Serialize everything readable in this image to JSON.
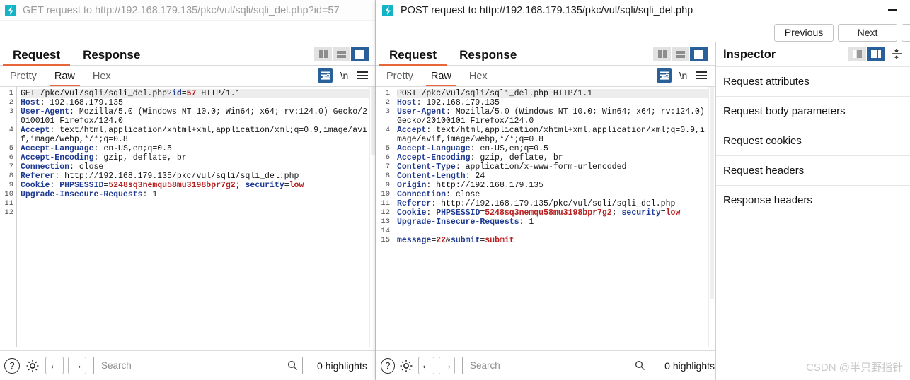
{
  "window_left": {
    "title": "GET request to http://192.168.179.135/pkc/vul/sqli/sqli_del.php?id=57",
    "logo_icon": "burp-suite-logo-icon",
    "tabs": [
      {
        "label": "Request",
        "active": true
      },
      {
        "label": "Response",
        "active": false
      }
    ],
    "layout_buttons": [
      {
        "name": "layout-side-by-side-icon",
        "selected": false
      },
      {
        "name": "layout-stacked-icon",
        "selected": false
      },
      {
        "name": "layout-single-pane-icon",
        "selected": true
      }
    ],
    "subtabs": [
      {
        "label": "Pretty",
        "active": false
      },
      {
        "label": "Raw",
        "active": true
      },
      {
        "label": "Hex",
        "active": false
      }
    ],
    "subtools": {
      "wrap_icon": "word-wrap-icon",
      "newline_label": "\\n",
      "menu_icon": "hamburger-menu-icon"
    },
    "code_lines": [
      {
        "n": "1",
        "segments": [
          {
            "t": "GET /pkc/vul/sqli/sqli_del.php?",
            "c": "pl"
          },
          {
            "t": "id",
            "c": "bl"
          },
          {
            "t": "=",
            "c": "pl"
          },
          {
            "t": "57",
            "c": "rd"
          },
          {
            "t": " HTTP/1.1",
            "c": "pl"
          }
        ]
      },
      {
        "n": "2",
        "segments": [
          {
            "t": "Host",
            "c": "hk"
          },
          {
            "t": ": 192.168.179.135",
            "c": "pl"
          }
        ]
      },
      {
        "n": "3",
        "segments": [
          {
            "t": "User-Agent",
            "c": "hk"
          },
          {
            "t": ": Mozilla/5.0 (Windows NT 10.0; Win64; x64; rv:124.0) Gecko/20100101 Firefox/124.0",
            "c": "pl"
          }
        ]
      },
      {
        "n": "4",
        "segments": [
          {
            "t": "Accept",
            "c": "hk"
          },
          {
            "t": ": text/html,application/xhtml+xml,application/xml;q=0.9,image/avif,image/webp,*/*;q=0.8",
            "c": "pl"
          }
        ]
      },
      {
        "n": "5",
        "segments": [
          {
            "t": "Accept-Language",
            "c": "hk"
          },
          {
            "t": ": en-US,en;q=0.5",
            "c": "pl"
          }
        ]
      },
      {
        "n": "6",
        "segments": [
          {
            "t": "Accept-Encoding",
            "c": "hk"
          },
          {
            "t": ": gzip, deflate, br",
            "c": "pl"
          }
        ]
      },
      {
        "n": "7",
        "segments": [
          {
            "t": "Connection",
            "c": "hk"
          },
          {
            "t": ": close",
            "c": "pl"
          }
        ]
      },
      {
        "n": "8",
        "segments": [
          {
            "t": "Referer",
            "c": "hk"
          },
          {
            "t": ": http://192.168.179.135/pkc/vul/sqli/sqli_del.php",
            "c": "pl"
          }
        ]
      },
      {
        "n": "9",
        "segments": [
          {
            "t": "Cookie",
            "c": "hk"
          },
          {
            "t": ": ",
            "c": "pl"
          },
          {
            "t": "PHPSESSID",
            "c": "bl"
          },
          {
            "t": "=",
            "c": "pl"
          },
          {
            "t": "5248sq3nemqu58mu3198bpr7g2",
            "c": "rd"
          },
          {
            "t": "; ",
            "c": "pl"
          },
          {
            "t": "security",
            "c": "bl"
          },
          {
            "t": "=",
            "c": "pl"
          },
          {
            "t": "low",
            "c": "rd"
          }
        ]
      },
      {
        "n": "10",
        "segments": [
          {
            "t": "Upgrade-Insecure-Requests",
            "c": "hk"
          },
          {
            "t": ": 1",
            "c": "pl"
          }
        ]
      },
      {
        "n": "11",
        "segments": []
      },
      {
        "n": "12",
        "segments": []
      }
    ],
    "bottom": {
      "help_label": "?",
      "help_icon": "help-circle-icon",
      "settings_icon": "gear-icon",
      "back_icon": "arrow-left-icon",
      "forward_icon": "arrow-right-icon",
      "search_placeholder": "Search",
      "search_value": "",
      "search_icon": "magnifier-icon",
      "highlights_label": "0 highlights"
    }
  },
  "window_right": {
    "title": "POST request to http://192.168.179.135/pkc/vul/sqli/sqli_del.php",
    "logo_icon": "burp-suite-logo-icon",
    "minimize_icon": "minimize-icon",
    "nav_buttons": [
      {
        "label": "Previous",
        "name": "previous-button"
      },
      {
        "label": "Next",
        "name": "next-button"
      }
    ],
    "tabs": [
      {
        "label": "Request",
        "active": true
      },
      {
        "label": "Response",
        "active": false
      }
    ],
    "layout_buttons": [
      {
        "name": "layout-side-by-side-icon",
        "selected": false
      },
      {
        "name": "layout-stacked-icon",
        "selected": false
      },
      {
        "name": "layout-single-pane-icon",
        "selected": true
      }
    ],
    "subtabs": [
      {
        "label": "Pretty",
        "active": false
      },
      {
        "label": "Raw",
        "active": true
      },
      {
        "label": "Hex",
        "active": false
      }
    ],
    "subtools": {
      "wrap_icon": "word-wrap-icon",
      "newline_label": "\\n",
      "menu_icon": "hamburger-menu-icon"
    },
    "code_lines": [
      {
        "n": "1",
        "segments": [
          {
            "t": "POST /pkc/vul/sqli/sqli_del.php HTTP/1.1",
            "c": "pl"
          }
        ]
      },
      {
        "n": "2",
        "segments": [
          {
            "t": "Host",
            "c": "hk"
          },
          {
            "t": ": 192.168.179.135",
            "c": "pl"
          }
        ]
      },
      {
        "n": "3",
        "segments": [
          {
            "t": "User-Agent",
            "c": "hk"
          },
          {
            "t": ": Mozilla/5.0 (Windows NT 10.0; Win64; x64; rv:124.0) Gecko/20100101 Firefox/124.0",
            "c": "pl"
          }
        ]
      },
      {
        "n": "4",
        "segments": [
          {
            "t": "Accept",
            "c": "hk"
          },
          {
            "t": ": text/html,application/xhtml+xml,application/xml;q=0.9,image/avif,image/webp,*/*;q=0.8",
            "c": "pl"
          }
        ]
      },
      {
        "n": "5",
        "segments": [
          {
            "t": "Accept-Language",
            "c": "hk"
          },
          {
            "t": ": en-US,en;q=0.5",
            "c": "pl"
          }
        ]
      },
      {
        "n": "6",
        "segments": [
          {
            "t": "Accept-Encoding",
            "c": "hk"
          },
          {
            "t": ": gzip, deflate, br",
            "c": "pl"
          }
        ]
      },
      {
        "n": "7",
        "segments": [
          {
            "t": "Content-Type",
            "c": "hk"
          },
          {
            "t": ": application/x-www-form-urlencoded",
            "c": "pl"
          }
        ]
      },
      {
        "n": "8",
        "segments": [
          {
            "t": "Content-Length",
            "c": "hk"
          },
          {
            "t": ": 24",
            "c": "pl"
          }
        ]
      },
      {
        "n": "9",
        "segments": [
          {
            "t": "Origin",
            "c": "hk"
          },
          {
            "t": ": http://192.168.179.135",
            "c": "pl"
          }
        ]
      },
      {
        "n": "10",
        "segments": [
          {
            "t": "Connection",
            "c": "hk"
          },
          {
            "t": ": close",
            "c": "pl"
          }
        ]
      },
      {
        "n": "11",
        "segments": [
          {
            "t": "Referer",
            "c": "hk"
          },
          {
            "t": ": http://192.168.179.135/pkc/vul/sqli/sqli_del.php",
            "c": "pl"
          }
        ]
      },
      {
        "n": "12",
        "segments": [
          {
            "t": "Cookie",
            "c": "hk"
          },
          {
            "t": ": ",
            "c": "pl"
          },
          {
            "t": "PHPSESSID",
            "c": "bl"
          },
          {
            "t": "=",
            "c": "pl"
          },
          {
            "t": "5248sq3nemqu58mu3198bpr7g2",
            "c": "rd"
          },
          {
            "t": "; ",
            "c": "pl"
          },
          {
            "t": "security",
            "c": "bl"
          },
          {
            "t": "=",
            "c": "pl"
          },
          {
            "t": "low",
            "c": "rd"
          }
        ]
      },
      {
        "n": "13",
        "segments": [
          {
            "t": "Upgrade-Insecure-Requests",
            "c": "hk"
          },
          {
            "t": ": 1",
            "c": "pl"
          }
        ]
      },
      {
        "n": "14",
        "segments": []
      },
      {
        "n": "15",
        "segments": [
          {
            "t": "message",
            "c": "bl"
          },
          {
            "t": "=",
            "c": "pl"
          },
          {
            "t": "22",
            "c": "rd"
          },
          {
            "t": "&",
            "c": "pl"
          },
          {
            "t": "submit",
            "c": "bl"
          },
          {
            "t": "=",
            "c": "pl"
          },
          {
            "t": "submit",
            "c": "rd"
          }
        ]
      }
    ],
    "bottom": {
      "help_label": "?",
      "help_icon": "help-circle-icon",
      "settings_icon": "gear-icon",
      "back_icon": "arrow-left-icon",
      "forward_icon": "arrow-right-icon",
      "search_placeholder": "Search",
      "search_value": "",
      "search_icon": "magnifier-icon",
      "highlights_label": "0 highlights"
    }
  },
  "inspector": {
    "title": "Inspector",
    "view_buttons": [
      {
        "name": "inspector-dock-left-icon",
        "selected": false
      },
      {
        "name": "inspector-dock-right-icon",
        "selected": true
      }
    ],
    "collapse_icon": "collapse-all-icon",
    "rows": [
      {
        "label": "Request attributes"
      },
      {
        "label": "Request body parameters"
      },
      {
        "label": "Request cookies"
      },
      {
        "label": "Request headers"
      },
      {
        "label": "Response headers"
      }
    ]
  },
  "watermark": "CSDN @半只野指针"
}
